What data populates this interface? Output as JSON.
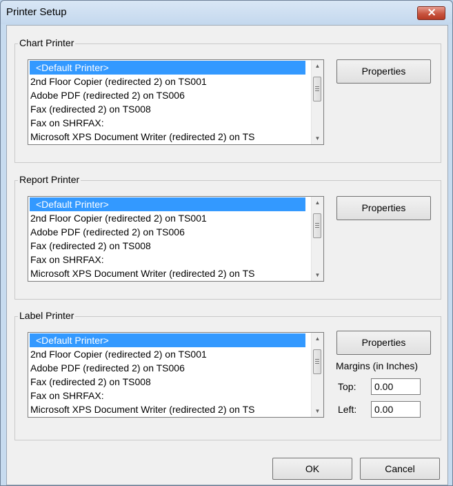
{
  "window": {
    "title": "Printer Setup",
    "close_label": "×"
  },
  "printers": [
    "<Default Printer>",
    "2nd Floor Copier (redirected 2) on TS001",
    "Adobe PDF (redirected 2) on TS006",
    "Fax (redirected 2) on TS008",
    "Fax on SHRFAX:",
    "Microsoft XPS Document Writer (redirected 2) on TS"
  ],
  "chart": {
    "legend": "Chart Printer",
    "properties_label": "Properties",
    "selected": "<Default Printer>"
  },
  "report": {
    "legend": "Report Printer",
    "properties_label": "Properties",
    "selected": "<Default Printer>"
  },
  "label": {
    "legend": "Label Printer",
    "properties_label": "Properties",
    "selected": "<Default Printer>",
    "margins_label": "Margins (in Inches)",
    "top_label": "Top:",
    "top_value": "0.00",
    "left_label": "Left:",
    "left_value": "0.00"
  },
  "footer": {
    "ok_label": "OK",
    "cancel_label": "Cancel"
  },
  "icons": {
    "scroll_up": "scroll-up-arrow-icon",
    "scroll_down": "scroll-down-arrow-icon",
    "thumb": "scroll-thumb-grip-icon",
    "close": "close-icon"
  },
  "colors": {
    "selection": "#3399ff",
    "close_button": "#c85540"
  }
}
